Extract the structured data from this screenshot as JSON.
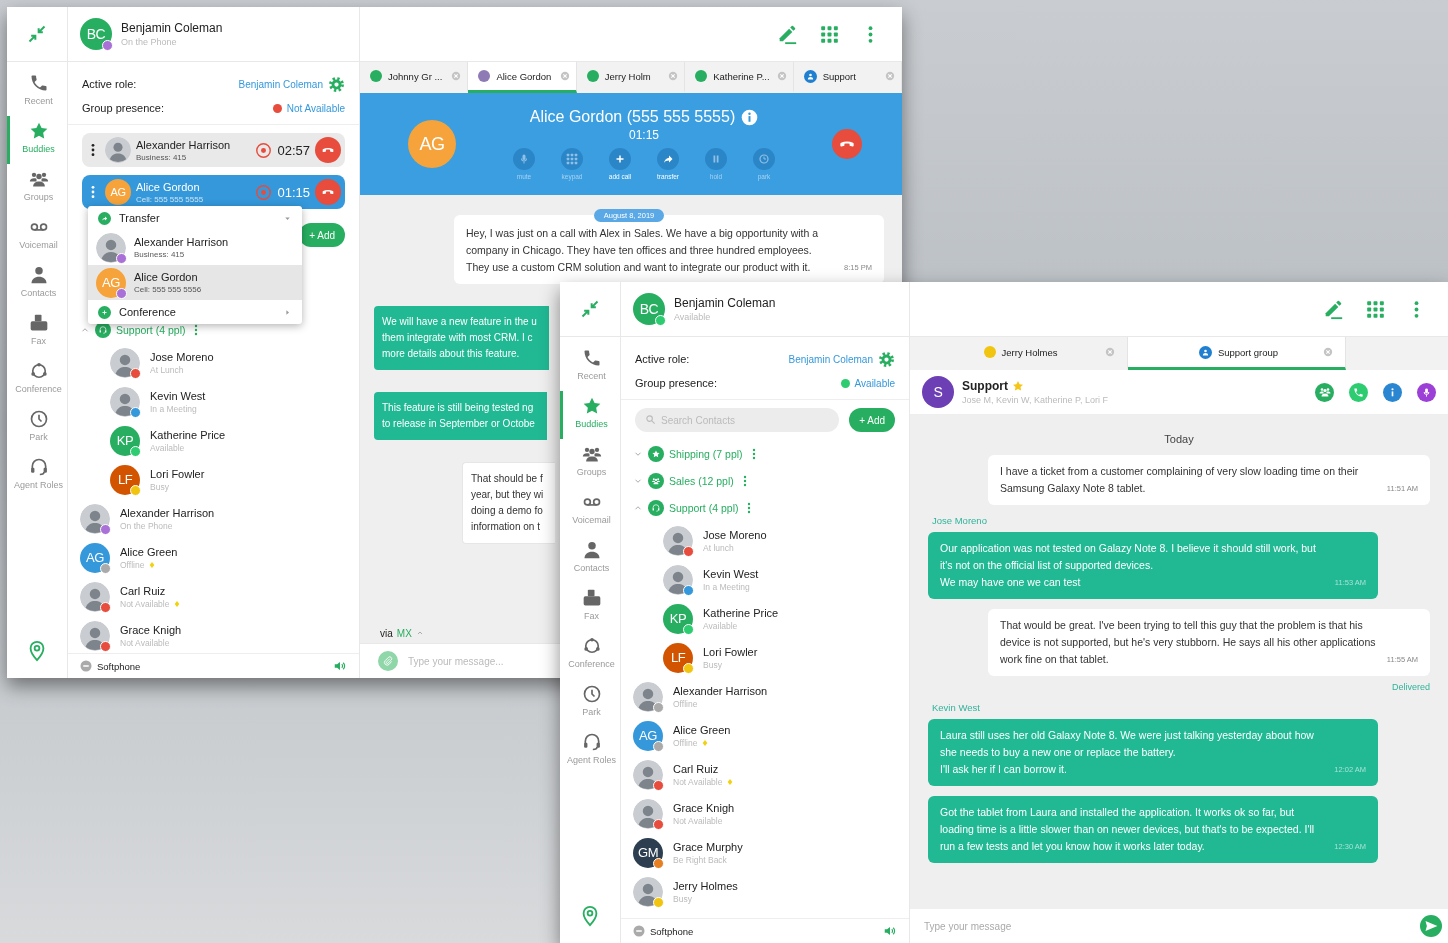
{
  "back_window": {
    "nav": [
      {
        "label": "Recent",
        "selected": false
      },
      {
        "label": "Buddies",
        "selected": true
      },
      {
        "label": "Groups",
        "selected": false
      },
      {
        "label": "Voicemail",
        "selected": false
      },
      {
        "label": "Contacts",
        "selected": false
      },
      {
        "label": "Fax",
        "selected": false
      },
      {
        "label": "Conference",
        "selected": false
      },
      {
        "label": "Park",
        "selected": false
      },
      {
        "label": "Agent Roles",
        "selected": false
      }
    ],
    "user": {
      "avatar": {
        "initials": "BC",
        "color": "#27ae60"
      },
      "name": "Benjamin Coleman",
      "status": "On the Phone",
      "color": "#a970d8"
    },
    "role": {
      "label": "Active role:",
      "value": "Benjamin Coleman"
    },
    "presence": {
      "label": "Group presence:",
      "value": "Not Available",
      "color": "#e74c3c"
    },
    "active_calls": [
      {
        "name": "Alexander Harrison",
        "detail": "Business: 415",
        "timer": "02:57",
        "selected": false
      },
      {
        "avatar": {
          "initials": "AG",
          "color": "#f5a33a"
        },
        "name": "Alice Gordon",
        "detail": "Cell: 555 555 5555",
        "timer": "01:15",
        "selected": true
      }
    ],
    "add_button": "+ Add",
    "menu": {
      "items": [
        {
          "kind": "action",
          "label": "Transfer",
          "expanded": true
        },
        {
          "kind": "contact",
          "name": "Alexander Harrison",
          "detail": "Business: 415",
          "color": "#a970d8",
          "selected": false
        },
        {
          "kind": "contact",
          "avatar": {
            "initials": "AG",
            "color": "#f5a33a"
          },
          "name": "Alice Gordon",
          "detail": "Cell: 555 555 5556",
          "color": "#a970d8",
          "selected": true
        },
        {
          "kind": "action",
          "label": "Conference",
          "expanded": false
        }
      ]
    },
    "groups": [
      {
        "label": "Support (4 ppl)",
        "expanded": true,
        "children": [
          {
            "name": "Jose Moreno",
            "status": "At Lunch",
            "color": "#e74c3c",
            "marked": false
          },
          {
            "name": "Kevin West",
            "status": "In a Meeting",
            "color": "#3498db",
            "marked": false
          },
          {
            "avatar": {
              "initials": "KP",
              "color": "#27ae60"
            },
            "name": "Katherine Price",
            "status": "Available",
            "color": "#2ecc71",
            "marked": false
          },
          {
            "avatar": {
              "initials": "LF",
              "color": "#d35400"
            },
            "name": "Lori Fowler",
            "status": "Busy",
            "color": "#f1c40f",
            "marked": false
          }
        ]
      }
    ],
    "contacts": [
      {
        "name": "Alexander Harrison",
        "status": "On the Phone",
        "color": "#a970d8",
        "marked": false
      },
      {
        "avatar": {
          "initials": "AG",
          "color": "#3498db"
        },
        "name": "Alice Green",
        "status": "Offline",
        "color": "#aaaaaa",
        "marked": true
      },
      {
        "name": "Carl Ruiz",
        "status": "Not Available",
        "color": "#e74c3c",
        "marked": true
      },
      {
        "name": "Grace Knigh",
        "status": "Not Available",
        "color": "#e74c3c",
        "marked": false
      }
    ],
    "footer": "Softphone",
    "tabs": [
      {
        "kind": "person",
        "label": "Johnny Gr ...",
        "color": "#27ae60",
        "selected": false
      },
      {
        "kind": "person",
        "label": "Alice Gordon",
        "color": "#8e7bb5",
        "selected": true
      },
      {
        "kind": "person",
        "label": "Jerry Holm",
        "color": "#27ae60",
        "selected": false
      },
      {
        "kind": "person",
        "label": "Katherine P...",
        "color": "#27ae60",
        "selected": false
      },
      {
        "kind": "group",
        "label": "Support",
        "selected": false
      }
    ],
    "call": {
      "avatar": {
        "initials": "AG",
        "color": "#f5a33a"
      },
      "title": "Alice Gordon (555 555 5555)",
      "timer": "01:15",
      "actions": [
        {
          "label": "mute",
          "disabled": true
        },
        {
          "label": "keypad",
          "disabled": true
        },
        {
          "label": "add call",
          "disabled": false
        },
        {
          "label": "transfer",
          "disabled": false
        },
        {
          "label": "hold",
          "disabled": true
        },
        {
          "label": "park",
          "disabled": true
        }
      ]
    },
    "date_chip": "August 8, 2019",
    "messages": [
      {
        "kind": "sent",
        "text": "Hey, I was just on a call with Alex in Sales. We have a big opportunity with a company in Chicago. They have ten offices and three hundred employees. They use a custom CRM solution and want to integrate our product with it.",
        "time": "8:15 PM"
      },
      {
        "kind": "received",
        "text": "We will have a new feature in the u\nthem integrate with most CRM. I c\nmore details about this feature."
      },
      {
        "kind": "received",
        "text": "This feature is still being tested ng\nto release in September or Octobe"
      },
      {
        "kind": "sent",
        "text": "That should be f\nyear, but they wi\ndoing a demo fo\ninformation on t"
      }
    ],
    "via": {
      "label": "via",
      "value": "MX"
    },
    "input_placeholder": "Type your message..."
  },
  "front_window": {
    "nav": [
      {
        "label": "Recent",
        "selected": false
      },
      {
        "label": "Buddies",
        "selected": true
      },
      {
        "label": "Groups",
        "selected": false
      },
      {
        "label": "Voicemail",
        "selected": false
      },
      {
        "label": "Contacts",
        "selected": false
      },
      {
        "label": "Fax",
        "selected": false
      },
      {
        "label": "Conference",
        "selected": false
      },
      {
        "label": "Park",
        "selected": false
      },
      {
        "label": "Agent Roles",
        "selected": false
      }
    ],
    "user": {
      "avatar": {
        "initials": "BC",
        "color": "#27ae60"
      },
      "name": "Benjamin Coleman",
      "status": "Available",
      "color": "#2ecc71"
    },
    "role": {
      "label": "Active role:",
      "value": "Benjamin Coleman"
    },
    "presence": {
      "label": "Group presence:",
      "value": "Available",
      "color": "#2ecc71"
    },
    "search": {
      "placeholder": "Search Contacts"
    },
    "add_button": "+ Add",
    "groups": [
      {
        "label": "Shipping (7 ppl)",
        "expanded": false
      },
      {
        "label": "Sales (12 ppl)",
        "expanded": false
      },
      {
        "label": "Support (4 ppl)",
        "expanded": true,
        "children": [
          {
            "name": "Jose Moreno",
            "status": "At lunch",
            "color": "#e74c3c",
            "marked": false
          },
          {
            "name": "Kevin West",
            "status": "In a Meeting",
            "color": "#3498db",
            "marked": false
          },
          {
            "avatar": {
              "initials": "KP",
              "color": "#27ae60"
            },
            "name": "Katherine Price",
            "status": "Available",
            "color": "#2ecc71",
            "marked": false
          },
          {
            "avatar": {
              "initials": "LF",
              "color": "#d35400"
            },
            "name": "Lori Fowler",
            "status": "Busy",
            "color": "#f1c40f",
            "marked": false
          }
        ]
      }
    ],
    "contacts": [
      {
        "name": "Alexander Harrison",
        "status": "Offline",
        "color": "#aaaaaa",
        "marked": false
      },
      {
        "avatar": {
          "initials": "AG",
          "color": "#3498db"
        },
        "name": "Alice Green",
        "status": "Offline",
        "color": "#aaaaaa",
        "marked": true
      },
      {
        "name": "Carl Ruiz",
        "status": "Not Available",
        "color": "#e74c3c",
        "marked": true
      },
      {
        "name": "Grace Knigh",
        "status": "Not Available",
        "color": "#e74c3c",
        "marked": false
      },
      {
        "avatar": {
          "initials": "GM",
          "color": "#2c3e50"
        },
        "name": "Grace Murphy",
        "status": "Be Right Back",
        "color": "#e67e22",
        "marked": false
      },
      {
        "name": "Jerry Holmes",
        "status": "Busy",
        "color": "#f1c40f",
        "marked": false
      }
    ],
    "footer": "Softphone",
    "tabs": [
      {
        "kind": "person",
        "label": "Jerry Holmes",
        "color": "#f1c40f",
        "selected": false
      },
      {
        "kind": "group",
        "label": "Support group",
        "selected": true
      }
    ],
    "chat_header": {
      "avatar": {
        "initials": "S",
        "color": "#6c3fb5"
      },
      "name": "Support",
      "members": "Jose M, Kevin W, Katherine P, Lori F"
    },
    "day": "Today",
    "messages": [
      {
        "kind": "sent",
        "text": "I have a ticket from a customer complaining of very slow loading time on their Samsung Galaxy Note 8 tablet.",
        "time": "11:51 AM"
      },
      {
        "kind": "received",
        "sender": "Jose Moreno",
        "text": "Our application was not tested on Galazy Note 8. I believe it should still work, but it's not on the official list of supported devices.\nWe may have one we can test",
        "time": "11:53 AM"
      },
      {
        "kind": "sent",
        "text": "That would be great. I've been trying to tell this guy that the problem is that his device is not supported, but he's very stubborn. He says all his other applications work fine on that tablet.",
        "time": "11:55 AM",
        "status": "Delivered"
      },
      {
        "kind": "received",
        "sender": "Kevin West",
        "text": "Laura still uses her old Galaxy Note 8. We were just talking yesterday about how she needs to buy a new one or replace the battery.\nI'll ask her if I can borrow it.",
        "time": "12:02 AM"
      },
      {
        "kind": "received",
        "text": "Got the tablet from Laura and installed the application. It works ok so far, but loading time is a little slower than on newer devices, but that's to be expected. I'll run a few tests and let you know how it works later today.",
        "time": "12:30 AM"
      }
    ],
    "input_placeholder": "Type your message"
  }
}
